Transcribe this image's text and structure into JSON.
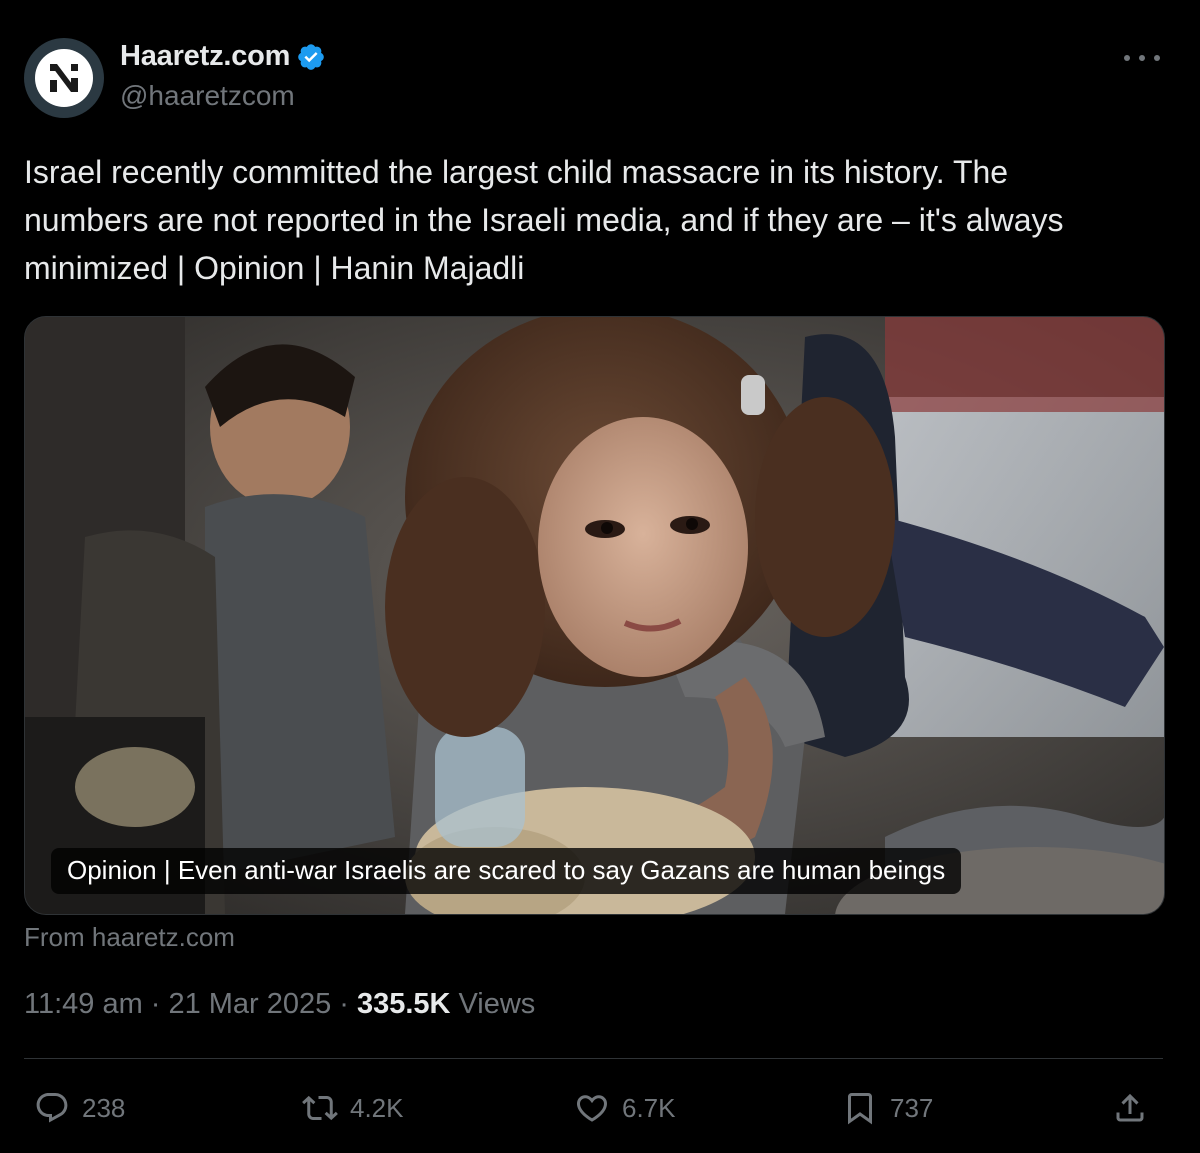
{
  "account": {
    "display_name": "Haaretz.com",
    "handle": "@haaretzcom",
    "avatar_letter": "א",
    "verified": true
  },
  "tweet": {
    "text": "Israel recently committed the largest child massacre in its history. The\nnumbers are not reported in the Israeli media, and if they are – it's always\nminimized | Opinion | Hanin Majadli"
  },
  "card": {
    "caption": "Opinion | Even anti-war Israelis are scared to say Gazans are human beings",
    "source": "From haaretz.com"
  },
  "meta": {
    "time": "11:49 am",
    "date": "21 Mar 2025",
    "views_count": "335.5K",
    "views_label": "Views"
  },
  "actions": {
    "replies": "238",
    "reposts": "4.2K",
    "likes": "6.7K",
    "bookmarks": "737"
  },
  "colors": {
    "background": "#000000",
    "text_primary": "#e7e9ea",
    "text_secondary": "#71767b",
    "verified_blue": "#1d9bf0",
    "divider": "#2f3336"
  }
}
